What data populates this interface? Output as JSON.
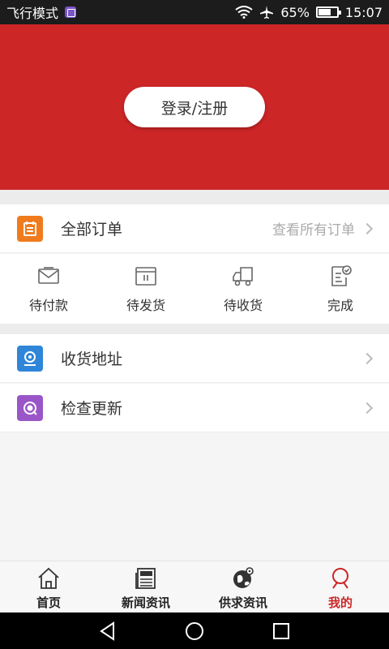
{
  "status_bar": {
    "mode": "飞行模式",
    "battery": "65%",
    "battery_level": 0.65,
    "time": "15:07"
  },
  "header": {
    "login_label": "登录/注册",
    "background": "#cd2627"
  },
  "orders": {
    "title": "全部订单",
    "view_all": "查看所有订单",
    "icon": "order-list-icon",
    "status_items": [
      {
        "label": "待付款",
        "icon": "payment-envelope-icon"
      },
      {
        "label": "待发货",
        "icon": "shipment-box-icon"
      },
      {
        "label": "待收货",
        "icon": "delivery-truck-icon"
      },
      {
        "label": "完成",
        "icon": "completed-document-icon"
      }
    ]
  },
  "menu": [
    {
      "label": "收货地址",
      "icon": "address-pin-icon",
      "color": "#2f86d8"
    },
    {
      "label": "检查更新",
      "icon": "update-check-icon",
      "color": "#9a56c8"
    }
  ],
  "tabs": [
    {
      "label": "首页",
      "icon": "home-icon"
    },
    {
      "label": "新闻资讯",
      "icon": "newspaper-icon"
    },
    {
      "label": "供求资讯",
      "icon": "globe-icon"
    },
    {
      "label": "我的",
      "icon": "profile-icon"
    }
  ],
  "accent_color": "#cd2627"
}
